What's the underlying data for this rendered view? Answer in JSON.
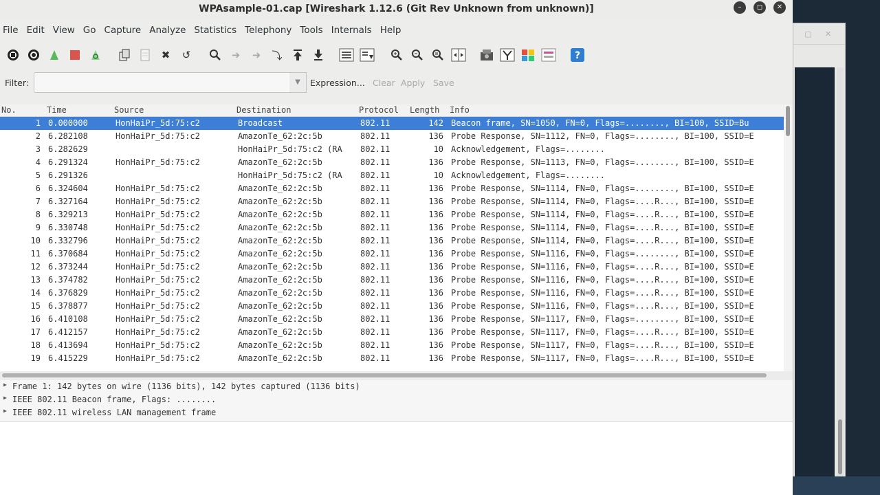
{
  "window": {
    "title": "WPAsample-01.cap  [Wireshark 1.12.6  (Git Rev Unknown from unknown)]",
    "controls": [
      "minimize",
      "maximize",
      "close"
    ]
  },
  "menu": [
    "File",
    "Edit",
    "View",
    "Go",
    "Capture",
    "Analyze",
    "Statistics",
    "Telephony",
    "Tools",
    "Internals",
    "Help"
  ],
  "toolbar_icons": [
    "interfaces-icon",
    "options-icon",
    "start-capture-icon",
    "stop-capture-icon",
    "restart-capture-icon",
    "open-icon",
    "save-icon",
    "close-file-icon",
    "reload-icon",
    "find-icon",
    "go-back-icon",
    "go-forward-icon",
    "go-to-packet-icon",
    "go-first-icon",
    "go-last-icon",
    "colorize-icon",
    "auto-scroll-icon",
    "zoom-in-icon",
    "zoom-out-icon",
    "normal-size-icon",
    "resize-columns-icon",
    "capture-filters-icon",
    "display-filters-icon",
    "coloring-rules-icon",
    "preferences-icon",
    "help-icon"
  ],
  "filter": {
    "label": "Filter:",
    "value": "",
    "expression": "Expression...",
    "clear": "Clear",
    "apply": "Apply",
    "save": "Save"
  },
  "columns": {
    "no": "No.",
    "time": "Time",
    "source": "Source",
    "destination": "Destination",
    "protocol": "Protocol",
    "length": "Length",
    "info": "Info"
  },
  "packets": [
    {
      "no": "1",
      "time": "0.000000",
      "src": "HonHaiPr_5d:75:c2",
      "dst": "Broadcast",
      "proto": "802.11",
      "len": "142",
      "info": "Beacon frame, SN=1050, FN=0, Flags=........, BI=100, SSID=Bu"
    },
    {
      "no": "2",
      "time": "6.282108",
      "src": "HonHaiPr_5d:75:c2",
      "dst": "AmazonTe_62:2c:5b",
      "proto": "802.11",
      "len": "136",
      "info": "Probe Response, SN=1112, FN=0, Flags=........, BI=100, SSID=E"
    },
    {
      "no": "3",
      "time": "6.282629",
      "src": "",
      "dst": "HonHaiPr_5d:75:c2 (RA",
      "proto": "802.11",
      "len": "10",
      "info": "Acknowledgement, Flags=........"
    },
    {
      "no": "4",
      "time": "6.291324",
      "src": "HonHaiPr_5d:75:c2",
      "dst": "AmazonTe_62:2c:5b",
      "proto": "802.11",
      "len": "136",
      "info": "Probe Response, SN=1113, FN=0, Flags=........, BI=100, SSID=E"
    },
    {
      "no": "5",
      "time": "6.291326",
      "src": "",
      "dst": "HonHaiPr_5d:75:c2 (RA",
      "proto": "802.11",
      "len": "10",
      "info": "Acknowledgement, Flags=........"
    },
    {
      "no": "6",
      "time": "6.324604",
      "src": "HonHaiPr_5d:75:c2",
      "dst": "AmazonTe_62:2c:5b",
      "proto": "802.11",
      "len": "136",
      "info": "Probe Response, SN=1114, FN=0, Flags=........, BI=100, SSID=E"
    },
    {
      "no": "7",
      "time": "6.327164",
      "src": "HonHaiPr_5d:75:c2",
      "dst": "AmazonTe_62:2c:5b",
      "proto": "802.11",
      "len": "136",
      "info": "Probe Response, SN=1114, FN=0, Flags=....R..., BI=100, SSID=E"
    },
    {
      "no": "8",
      "time": "6.329213",
      "src": "HonHaiPr_5d:75:c2",
      "dst": "AmazonTe_62:2c:5b",
      "proto": "802.11",
      "len": "136",
      "info": "Probe Response, SN=1114, FN=0, Flags=....R..., BI=100, SSID=E"
    },
    {
      "no": "9",
      "time": "6.330748",
      "src": "HonHaiPr_5d:75:c2",
      "dst": "AmazonTe_62:2c:5b",
      "proto": "802.11",
      "len": "136",
      "info": "Probe Response, SN=1114, FN=0, Flags=....R..., BI=100, SSID=E"
    },
    {
      "no": "10",
      "time": "6.332796",
      "src": "HonHaiPr_5d:75:c2",
      "dst": "AmazonTe_62:2c:5b",
      "proto": "802.11",
      "len": "136",
      "info": "Probe Response, SN=1114, FN=0, Flags=....R..., BI=100, SSID=E"
    },
    {
      "no": "11",
      "time": "6.370684",
      "src": "HonHaiPr_5d:75:c2",
      "dst": "AmazonTe_62:2c:5b",
      "proto": "802.11",
      "len": "136",
      "info": "Probe Response, SN=1116, FN=0, Flags=........, BI=100, SSID=E"
    },
    {
      "no": "12",
      "time": "6.373244",
      "src": "HonHaiPr_5d:75:c2",
      "dst": "AmazonTe_62:2c:5b",
      "proto": "802.11",
      "len": "136",
      "info": "Probe Response, SN=1116, FN=0, Flags=....R..., BI=100, SSID=E"
    },
    {
      "no": "13",
      "time": "6.374782",
      "src": "HonHaiPr_5d:75:c2",
      "dst": "AmazonTe_62:2c:5b",
      "proto": "802.11",
      "len": "136",
      "info": "Probe Response, SN=1116, FN=0, Flags=....R..., BI=100, SSID=E"
    },
    {
      "no": "14",
      "time": "6.376829",
      "src": "HonHaiPr_5d:75:c2",
      "dst": "AmazonTe_62:2c:5b",
      "proto": "802.11",
      "len": "136",
      "info": "Probe Response, SN=1116, FN=0, Flags=....R..., BI=100, SSID=E"
    },
    {
      "no": "15",
      "time": "6.378877",
      "src": "HonHaiPr_5d:75:c2",
      "dst": "AmazonTe_62:2c:5b",
      "proto": "802.11",
      "len": "136",
      "info": "Probe Response, SN=1116, FN=0, Flags=....R..., BI=100, SSID=E"
    },
    {
      "no": "16",
      "time": "6.410108",
      "src": "HonHaiPr_5d:75:c2",
      "dst": "AmazonTe_62:2c:5b",
      "proto": "802.11",
      "len": "136",
      "info": "Probe Response, SN=1117, FN=0, Flags=........, BI=100, SSID=E"
    },
    {
      "no": "17",
      "time": "6.412157",
      "src": "HonHaiPr_5d:75:c2",
      "dst": "AmazonTe_62:2c:5b",
      "proto": "802.11",
      "len": "136",
      "info": "Probe Response, SN=1117, FN=0, Flags=....R..., BI=100, SSID=E"
    },
    {
      "no": "18",
      "time": "6.413694",
      "src": "HonHaiPr_5d:75:c2",
      "dst": "AmazonTe_62:2c:5b",
      "proto": "802.11",
      "len": "136",
      "info": "Probe Response, SN=1117, FN=0, Flags=....R..., BI=100, SSID=E"
    },
    {
      "no": "19",
      "time": "6.415229",
      "src": "HonHaiPr_5d:75:c2",
      "dst": "AmazonTe_62:2c:5b",
      "proto": "802.11",
      "len": "136",
      "info": "Probe Response, SN=1117, FN=0, Flags=....R..., BI=100, SSID=E"
    }
  ],
  "selected_packet": "1",
  "details": [
    "Frame 1: 142 bytes on wire (1136 bits), 142 bytes captured (1136 bits)",
    "IEEE 802.11 Beacon frame, Flags: ........",
    "IEEE 802.11 wireless LAN management frame"
  ],
  "colors": {
    "selection": "#3d7fd6",
    "window_bg": "#ededec",
    "desktop": "#1c2a38"
  }
}
